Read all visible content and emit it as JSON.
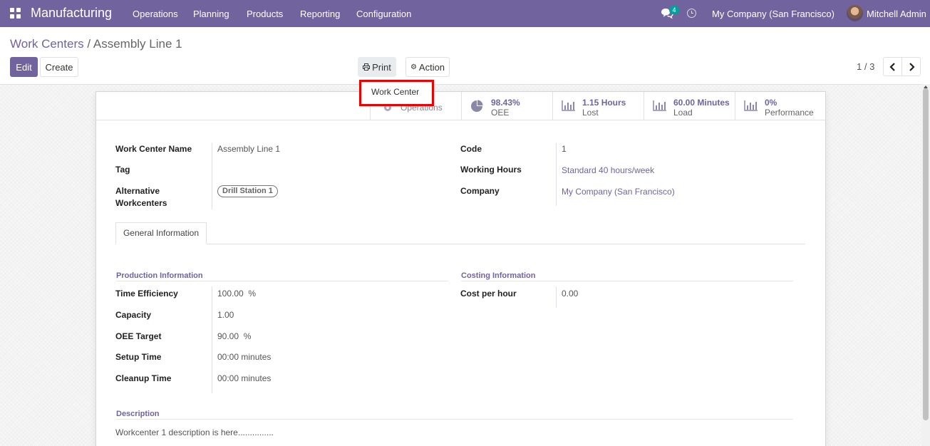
{
  "navbar": {
    "app_name": "Manufacturing",
    "menus": [
      "Operations",
      "Planning",
      "Products",
      "Reporting",
      "Configuration"
    ],
    "chat_count": "4",
    "company": "My Company (San Francisco)",
    "user": "Mitchell Admin",
    "icons": {
      "apps": "grid-icon",
      "chat": "chat-icon",
      "activity": "clock-icon"
    },
    "color": "#71639e"
  },
  "breadcrumb": {
    "parent": "Work Centers",
    "separator": "/",
    "current": "Assembly Line 1"
  },
  "toolbar": {
    "edit_label": "Edit",
    "create_label": "Create",
    "print_label": "Print",
    "action_label": "Action"
  },
  "pager": {
    "text": "1 / 3"
  },
  "print_menu": {
    "items": [
      "Work Center"
    ]
  },
  "stats": {
    "operations": {
      "label": "Operations"
    },
    "oee": {
      "value": "98.43%",
      "label": "OEE"
    },
    "lost": {
      "value": "1.15 Hours",
      "label": "Lost"
    },
    "load": {
      "value": "60.00 Minutes",
      "label": "Load"
    },
    "performance": {
      "value": "0%",
      "label": "Performance"
    }
  },
  "form": {
    "work_center_name": {
      "label": "Work Center Name",
      "value": "Assembly Line 1"
    },
    "tag": {
      "label": "Tag",
      "value": ""
    },
    "alternative_workcenters": {
      "label_line1": "Alternative",
      "label_line2": "Workcenters",
      "tags": [
        "Drill Station 1"
      ]
    },
    "code": {
      "label": "Code",
      "value": "1"
    },
    "working_hours": {
      "label": "Working Hours",
      "value": "Standard 40 hours/week"
    },
    "company": {
      "label": "Company",
      "value": "My Company (San Francisco)"
    }
  },
  "tabs": [
    {
      "label": "General Information",
      "active": true
    }
  ],
  "production": {
    "title": "Production Information",
    "fields": [
      {
        "label": "Time Efficiency",
        "value": "100.00",
        "unit": "%"
      },
      {
        "label": "Capacity",
        "value": "1.00",
        "unit": ""
      },
      {
        "label": "OEE Target",
        "value": "90.00",
        "unit": "%"
      },
      {
        "label": "Setup Time",
        "value": "00:00 minutes",
        "unit": ""
      },
      {
        "label": "Cleanup Time",
        "value": "00:00 minutes",
        "unit": ""
      }
    ]
  },
  "costing": {
    "title": "Costing Information",
    "fields": [
      {
        "label": "Cost per hour",
        "value": "0.00"
      }
    ]
  },
  "description": {
    "title": "Description",
    "text": "Workcenter 1 description is here..............."
  }
}
